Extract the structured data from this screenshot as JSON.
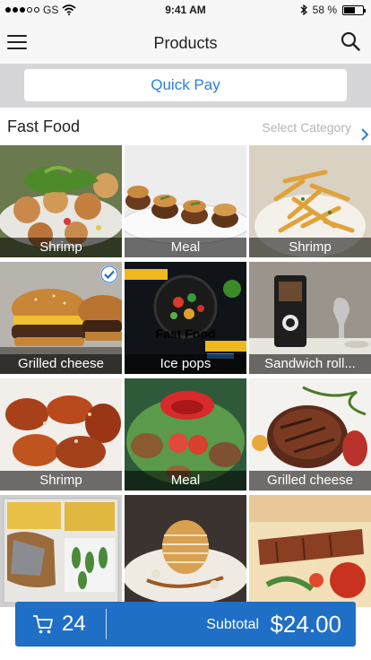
{
  "status_bar": {
    "carrier": "GS",
    "time": "9:41 AM",
    "battery": "58 %",
    "battery_level": 0.58
  },
  "header": {
    "title": "Products",
    "menu_icon": "hamburger-menu-icon",
    "search_icon": "search-icon"
  },
  "quick_pay": {
    "label": "Quick Pay"
  },
  "category": {
    "title": "Fast Food",
    "select_placeholder": "Select Category",
    "chevron_icon": "chevron-right-icon"
  },
  "products": [
    {
      "label": "Shrimp"
    },
    {
      "label": "Meal"
    },
    {
      "label": "Shrimp"
    },
    {
      "label": "Grilled cheese",
      "selected": true
    },
    {
      "label": "Ice pops",
      "overlay": "Fast Food"
    },
    {
      "label": "Sandwich roll..."
    },
    {
      "label": "Shrimp"
    },
    {
      "label": "Meal"
    },
    {
      "label": "Grilled cheese"
    },
    {
      "label": ""
    },
    {
      "label": ""
    },
    {
      "label": ""
    }
  ],
  "cart": {
    "count": "24",
    "subtotal_label": "Subtotal",
    "subtotal_value": "$24.00",
    "icon": "shopping-cart-icon"
  },
  "colors": {
    "accent": "#1f6fc7",
    "link": "#2a7fd8",
    "band": "#d6d6d8",
    "nav": "#f7f7f7"
  }
}
